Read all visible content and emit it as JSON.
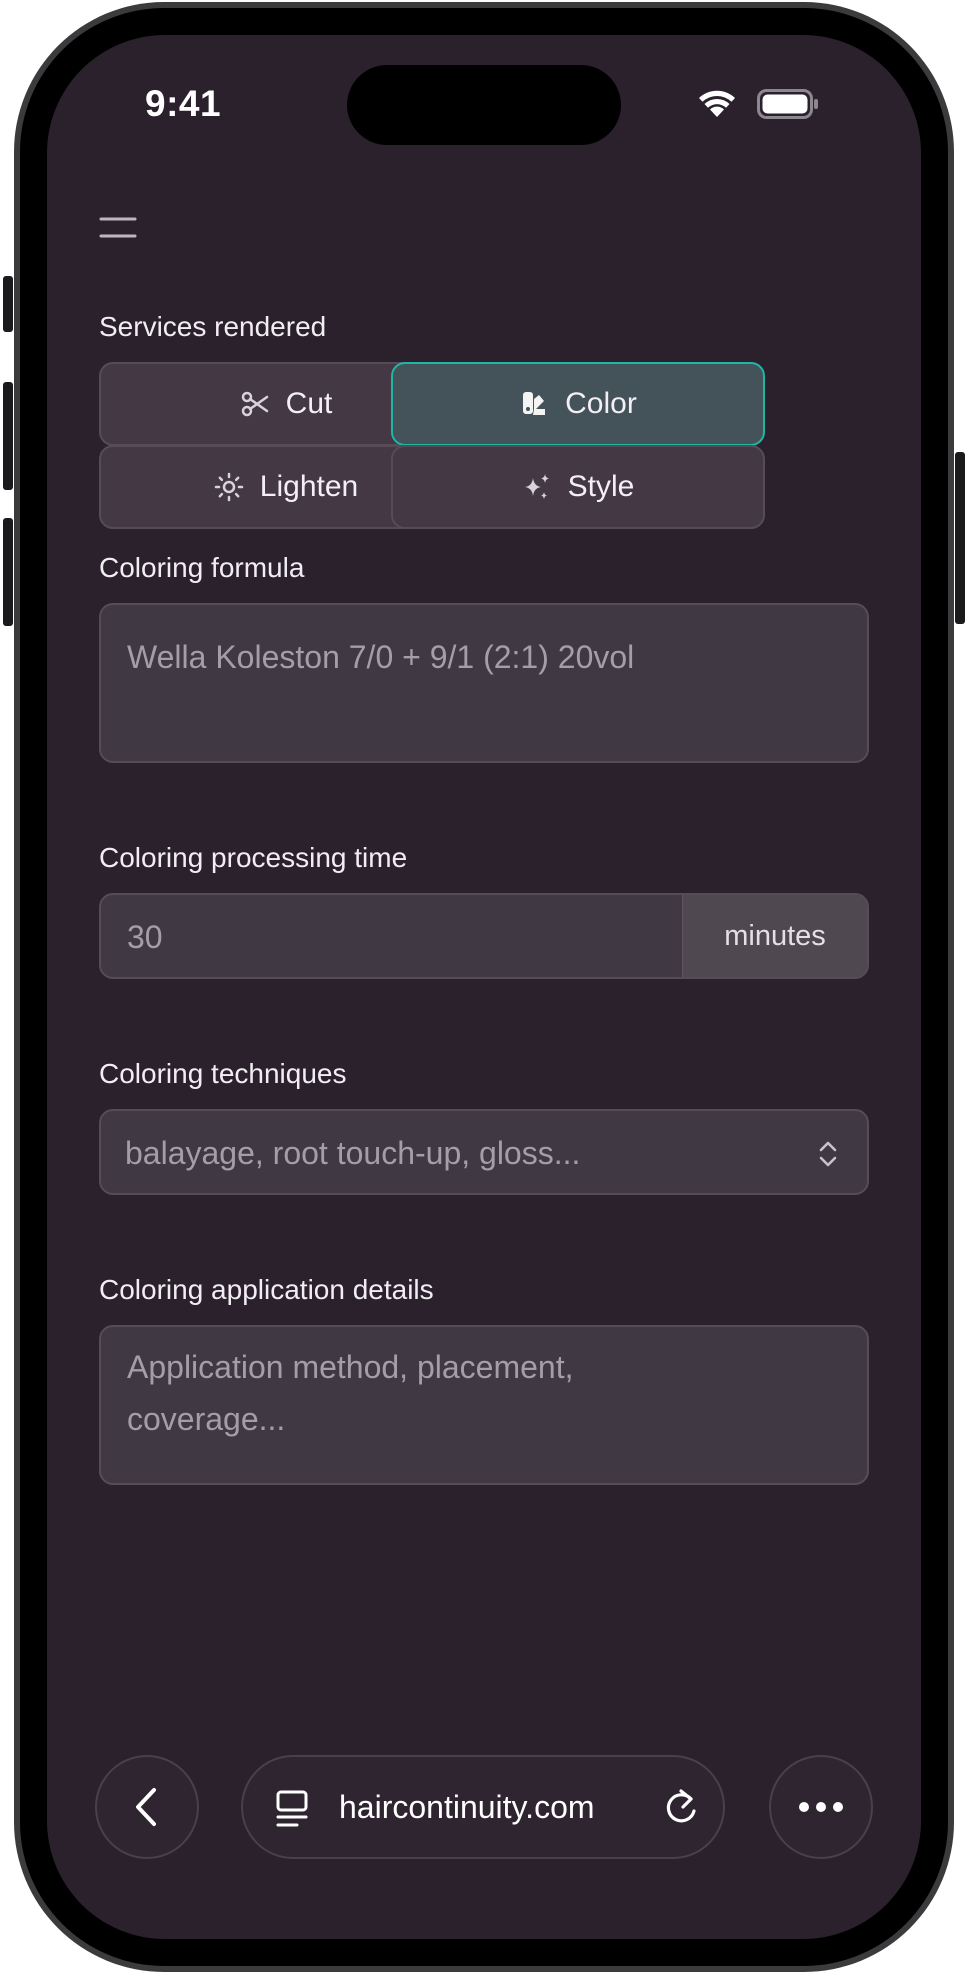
{
  "status_bar": {
    "time": "9:41"
  },
  "form": {
    "services_label": "Services rendered",
    "services": [
      {
        "label": "Cut",
        "icon": "scissors-icon",
        "selected": false
      },
      {
        "label": "Color",
        "icon": "color-swatch-icon",
        "selected": true
      },
      {
        "label": "Lighten",
        "icon": "sun-icon",
        "selected": false
      },
      {
        "label": "Style",
        "icon": "sparkles-icon",
        "selected": false
      }
    ],
    "formula_label": "Coloring formula",
    "formula_placeholder": "Wella Koleston 7/0 + 9/1 (2:1) 20vol",
    "time_label": "Coloring processing time",
    "time_placeholder": "30",
    "time_unit": "minutes",
    "techniques_label": "Coloring techniques",
    "techniques_placeholder": "balayage, root touch-up, gloss...",
    "details_label": "Coloring application details",
    "details_placeholder_line1": "Application method, placement,",
    "details_placeholder_line2": "coverage..."
  },
  "browser": {
    "url": "haircontinuity.com"
  },
  "colors": {
    "background": "#2a212c",
    "accent": "#1eb6a6",
    "button_bg": "#443845",
    "field_bg": "#403842"
  }
}
